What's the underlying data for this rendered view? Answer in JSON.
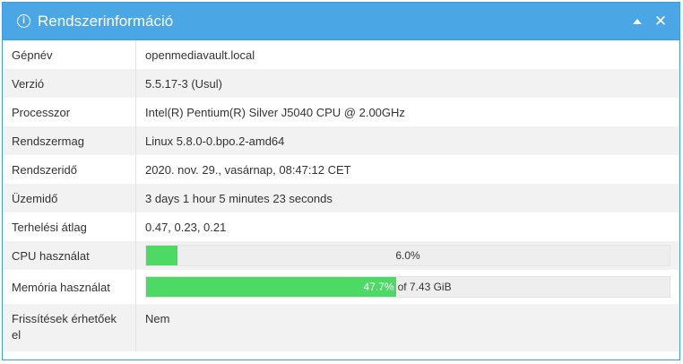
{
  "header": {
    "title": "Rendszerinformáció",
    "info_icon": "info-circle-icon",
    "collapse_icon": "caret-up-icon",
    "close_icon": "close-icon"
  },
  "rows": [
    {
      "label": "Gépnév",
      "value": "openmediavault.local"
    },
    {
      "label": "Verzió",
      "value": "5.5.17-3 (Usul)"
    },
    {
      "label": "Processzor",
      "value": "Intel(R) Pentium(R) Silver J5040 CPU @ 2.00GHz"
    },
    {
      "label": "Rendszermag",
      "value": "Linux 5.8.0-0.bpo.2-amd64"
    },
    {
      "label": "Rendszeridő",
      "value": "2020. nov. 29., vasárnap, 08:47:12 CET"
    },
    {
      "label": "Üzemidő",
      "value": "3 days 1 hour 5 minutes 23 seconds"
    },
    {
      "label": "Terhelési átlag",
      "value": "0.47, 0.23, 0.21"
    }
  ],
  "cpu": {
    "label": "CPU használat",
    "percent": 6.0,
    "text": "6.0%"
  },
  "memory": {
    "label": "Memória használat",
    "percent": 47.7,
    "percent_text": "47.7%",
    "rest_text": "of 7.43 GiB"
  },
  "updates": {
    "label": "Frissítések érhetőek el",
    "value": "Nem"
  },
  "colors": {
    "accent": "#4aa6e4",
    "bar_fill": "#4cd964",
    "bar_bg": "#eeeeee"
  }
}
